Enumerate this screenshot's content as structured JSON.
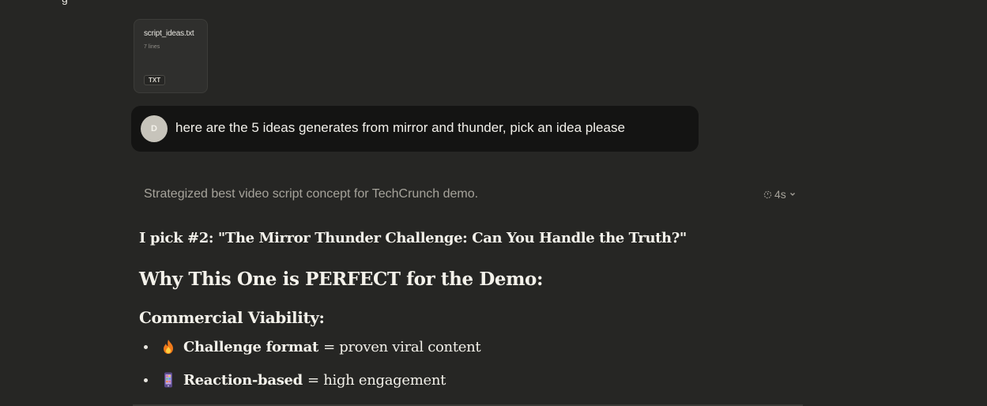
{
  "top_fragment": "g",
  "attachment": {
    "file_name": "script_ideas.txt",
    "line_count": "7 lines",
    "file_type": "TXT"
  },
  "user_message": {
    "avatar_initial": "D",
    "text": "here are the 5 ideas generates from mirror and thunder, pick an idea please"
  },
  "thinking": {
    "summary": "Strategized best video script concept for TechCrunch demo.",
    "duration": "4s",
    "icon": "timer-icon"
  },
  "response": {
    "pick_line": "I pick #2: \"The Mirror Thunder Challenge: Can You Handle the Truth?\"",
    "heading": "Why This One is PERFECT for the Demo:",
    "subheading": "Commercial Viability:",
    "bullets": [
      {
        "emoji": "fire-emoji",
        "bold": "Challenge format",
        "rest": "= proven viral content"
      },
      {
        "emoji": "mobile-phone-emoji",
        "bold": "Reaction-based",
        "rest": "= high engagement"
      }
    ]
  },
  "colors": {
    "background": "#262624",
    "user_bubble": "#141413",
    "text": "#f3f1ea",
    "muted_text": "#a6a39b"
  }
}
